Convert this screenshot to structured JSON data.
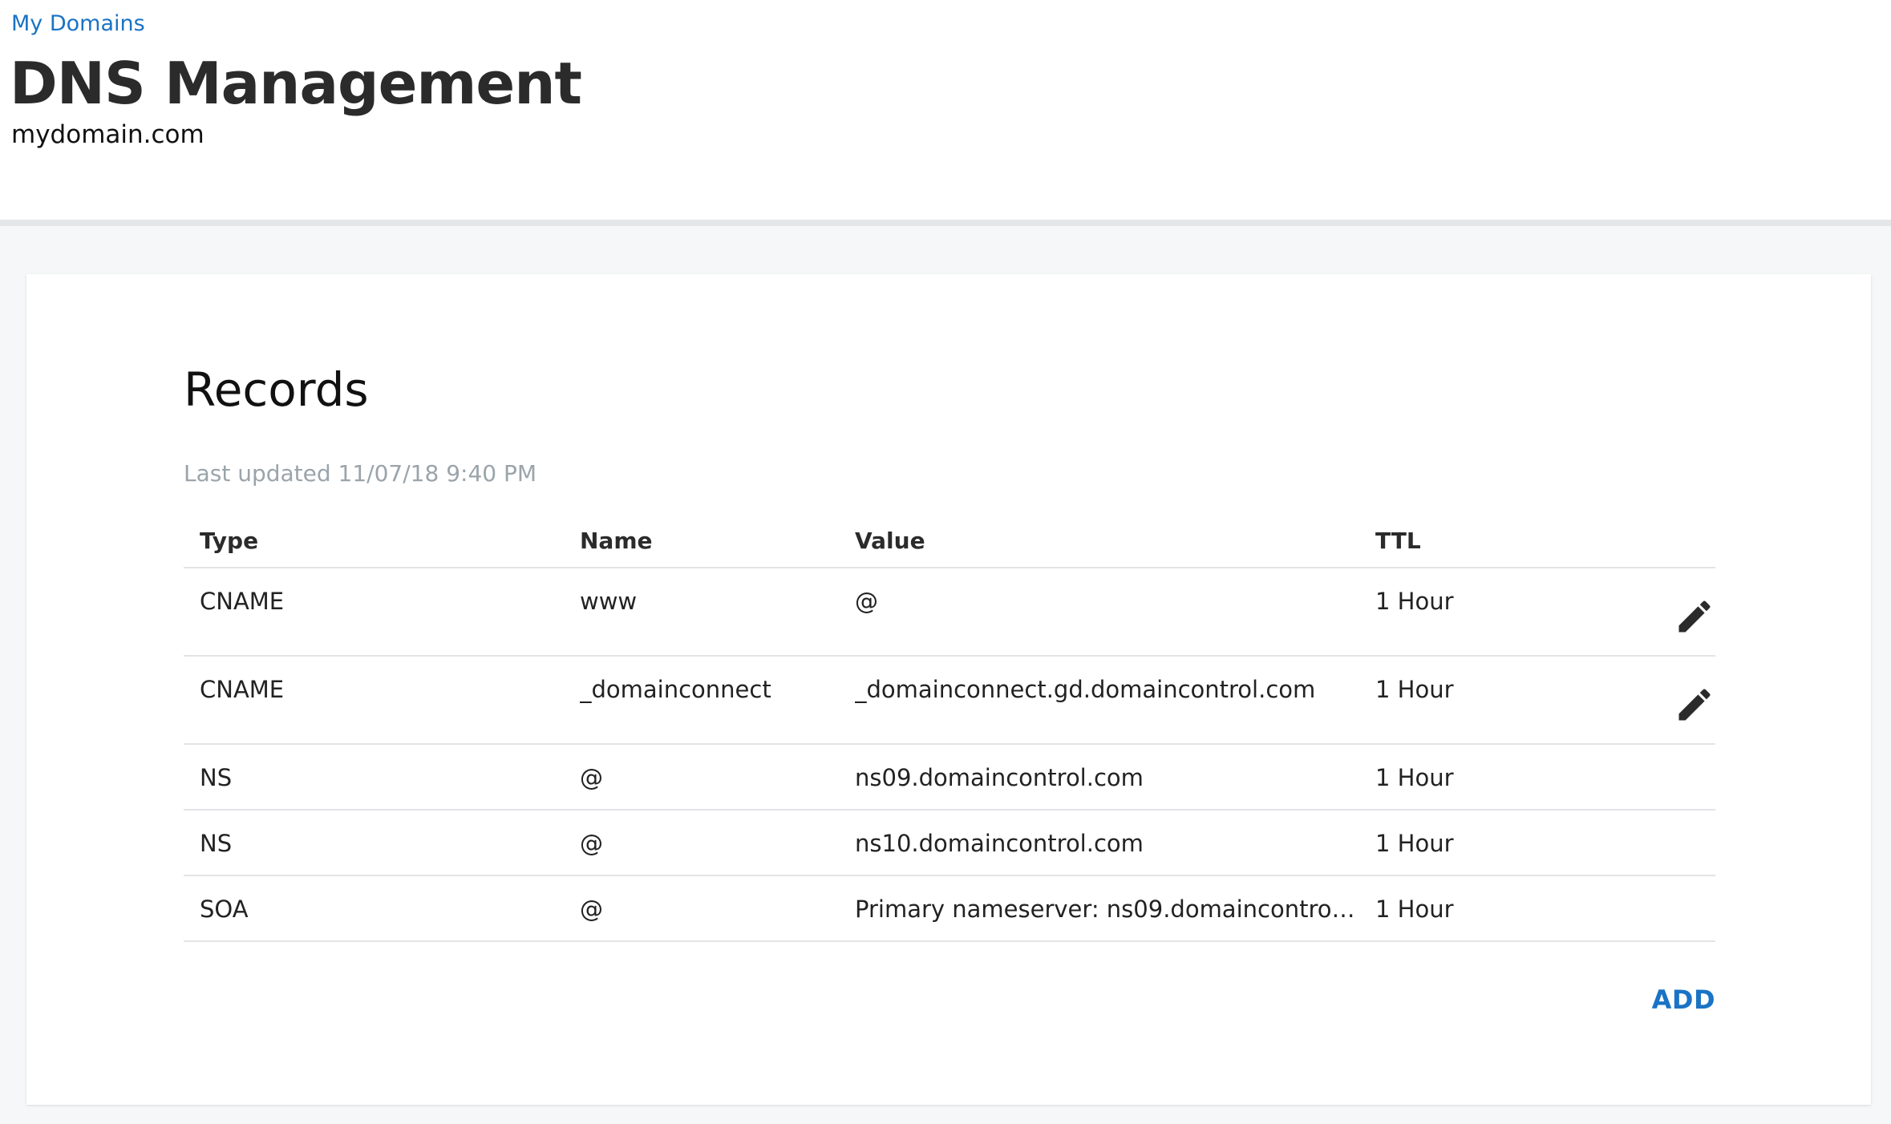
{
  "header": {
    "breadcrumb": "My Domains",
    "title": "DNS Management",
    "domain": "mydomain.com"
  },
  "records": {
    "title": "Records",
    "last_updated": "Last updated 11/07/18 9:40 PM",
    "columns": {
      "type": "Type",
      "name": "Name",
      "value": "Value",
      "ttl": "TTL"
    },
    "rows": [
      {
        "type": "CNAME",
        "name": "www",
        "value": "@",
        "ttl": "1 Hour",
        "action_icon": "pencil-icon"
      },
      {
        "type": "CNAME",
        "name": "_domainconnect",
        "value": "_domainconnect.gd.domaincontrol.com",
        "ttl": "1 Hour",
        "action_icon": "pencil-icon"
      },
      {
        "type": "NS",
        "name": "@",
        "value": "ns09.domaincontrol.com",
        "ttl": "1 Hour"
      },
      {
        "type": "NS",
        "name": "@",
        "value": "ns10.domaincontrol.com",
        "ttl": "1 Hour"
      },
      {
        "type": "SOA",
        "name": "@",
        "value": "Primary nameserver: ns09.domaincontrol.co…",
        "ttl": "1 Hour"
      }
    ],
    "add_label": "ADD"
  },
  "colors": {
    "accent": "#1a73c4",
    "muted_text": "#9aa4ab",
    "divider": "#e2e4e6",
    "background": "#f5f7f8"
  }
}
